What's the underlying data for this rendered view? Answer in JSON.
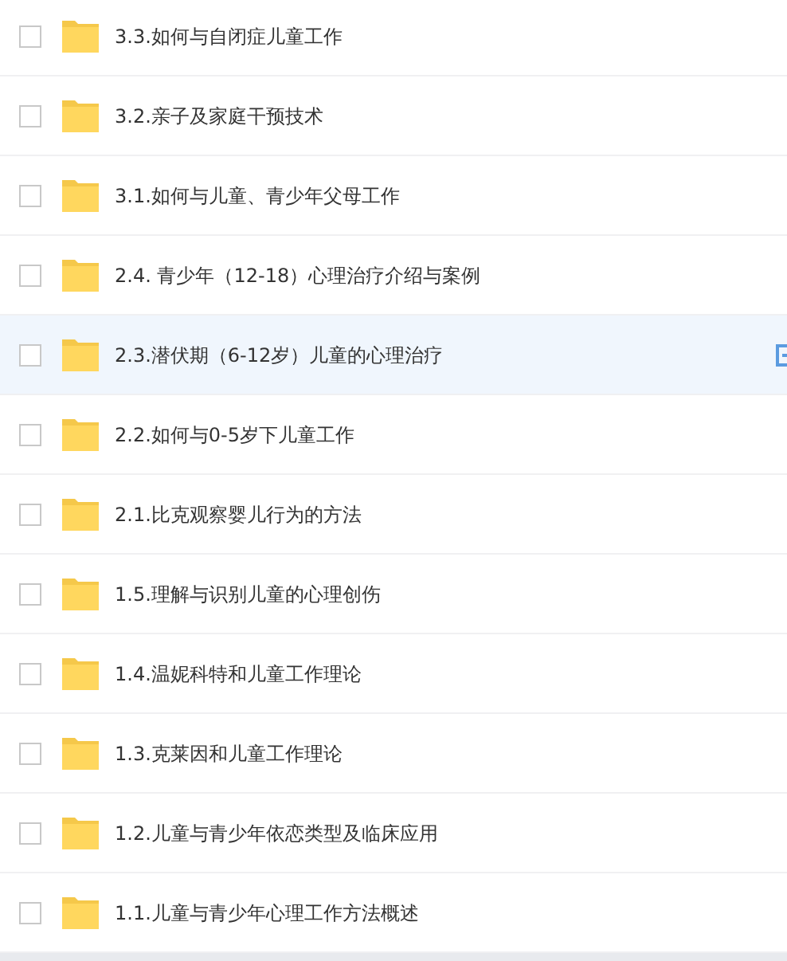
{
  "rows": [
    {
      "name": "3.3.如何与自闭症儿童工作",
      "checked": false,
      "hovered": false
    },
    {
      "name": "3.2.亲子及家庭干预技术",
      "checked": false,
      "hovered": false
    },
    {
      "name": "3.1.如何与儿童、青少年父母工作",
      "checked": false,
      "hovered": false
    },
    {
      "name": "2.4. 青少年（12-18）心理治疗介绍与案例",
      "checked": false,
      "hovered": false
    },
    {
      "name": "2.3.潜伏期（6-12岁）儿童的心理治疗",
      "checked": false,
      "hovered": true
    },
    {
      "name": "2.2.如何与0-5岁下儿童工作",
      "checked": false,
      "hovered": false
    },
    {
      "name": "2.1.比克观察婴儿行为的方法",
      "checked": false,
      "hovered": false
    },
    {
      "name": "1.5.理解与识别儿童的心理创伤",
      "checked": false,
      "hovered": false
    },
    {
      "name": "1.4.温妮科特和儿童工作理论",
      "checked": false,
      "hovered": false
    },
    {
      "name": "1.3.克莱因和儿童工作理论",
      "checked": false,
      "hovered": false
    },
    {
      "name": "1.2.儿童与青少年依恋类型及临床应用",
      "checked": false,
      "hovered": false
    },
    {
      "name": "1.1.儿童与青少年心理工作方法概述",
      "checked": false,
      "hovered": false
    }
  ]
}
